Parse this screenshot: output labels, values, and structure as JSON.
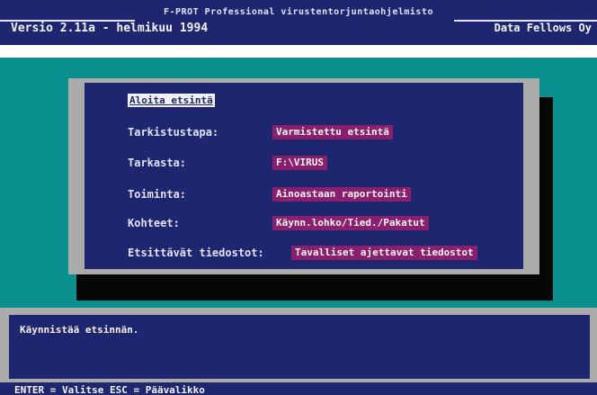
{
  "header": {
    "product": "F-PROT Professional virustentorjuntaohjelmisto",
    "version": "Versio 2.11a - helmikuu 1994",
    "company": "Data Fellows Oy"
  },
  "dialog": {
    "title": "Aloita etsintä",
    "fields": [
      {
        "label": "Tarkistustapa:",
        "value": "Varmistettu etsintä"
      },
      {
        "label": "Tarkasta:",
        "value": "F:\\VIRUS"
      },
      {
        "label": "Toiminta:",
        "value": "Ainoastaan raportointi"
      },
      {
        "label": "Kohteet:",
        "value": "Käynn.lohko/Tied./Pakatut"
      },
      {
        "label": "Etsittävät tiedostot:",
        "value": "Tavalliset ajettavat tiedostot"
      }
    ]
  },
  "message": {
    "text": "Käynnistää etsinnän."
  },
  "keybar": {
    "text": "ENTER = Valitse    ESC = Päävalikko"
  },
  "colors": {
    "navy": "#1f2670",
    "teal": "#0a8f8f",
    "gray": "#ababab",
    "highlight": "#8a1f6e"
  }
}
